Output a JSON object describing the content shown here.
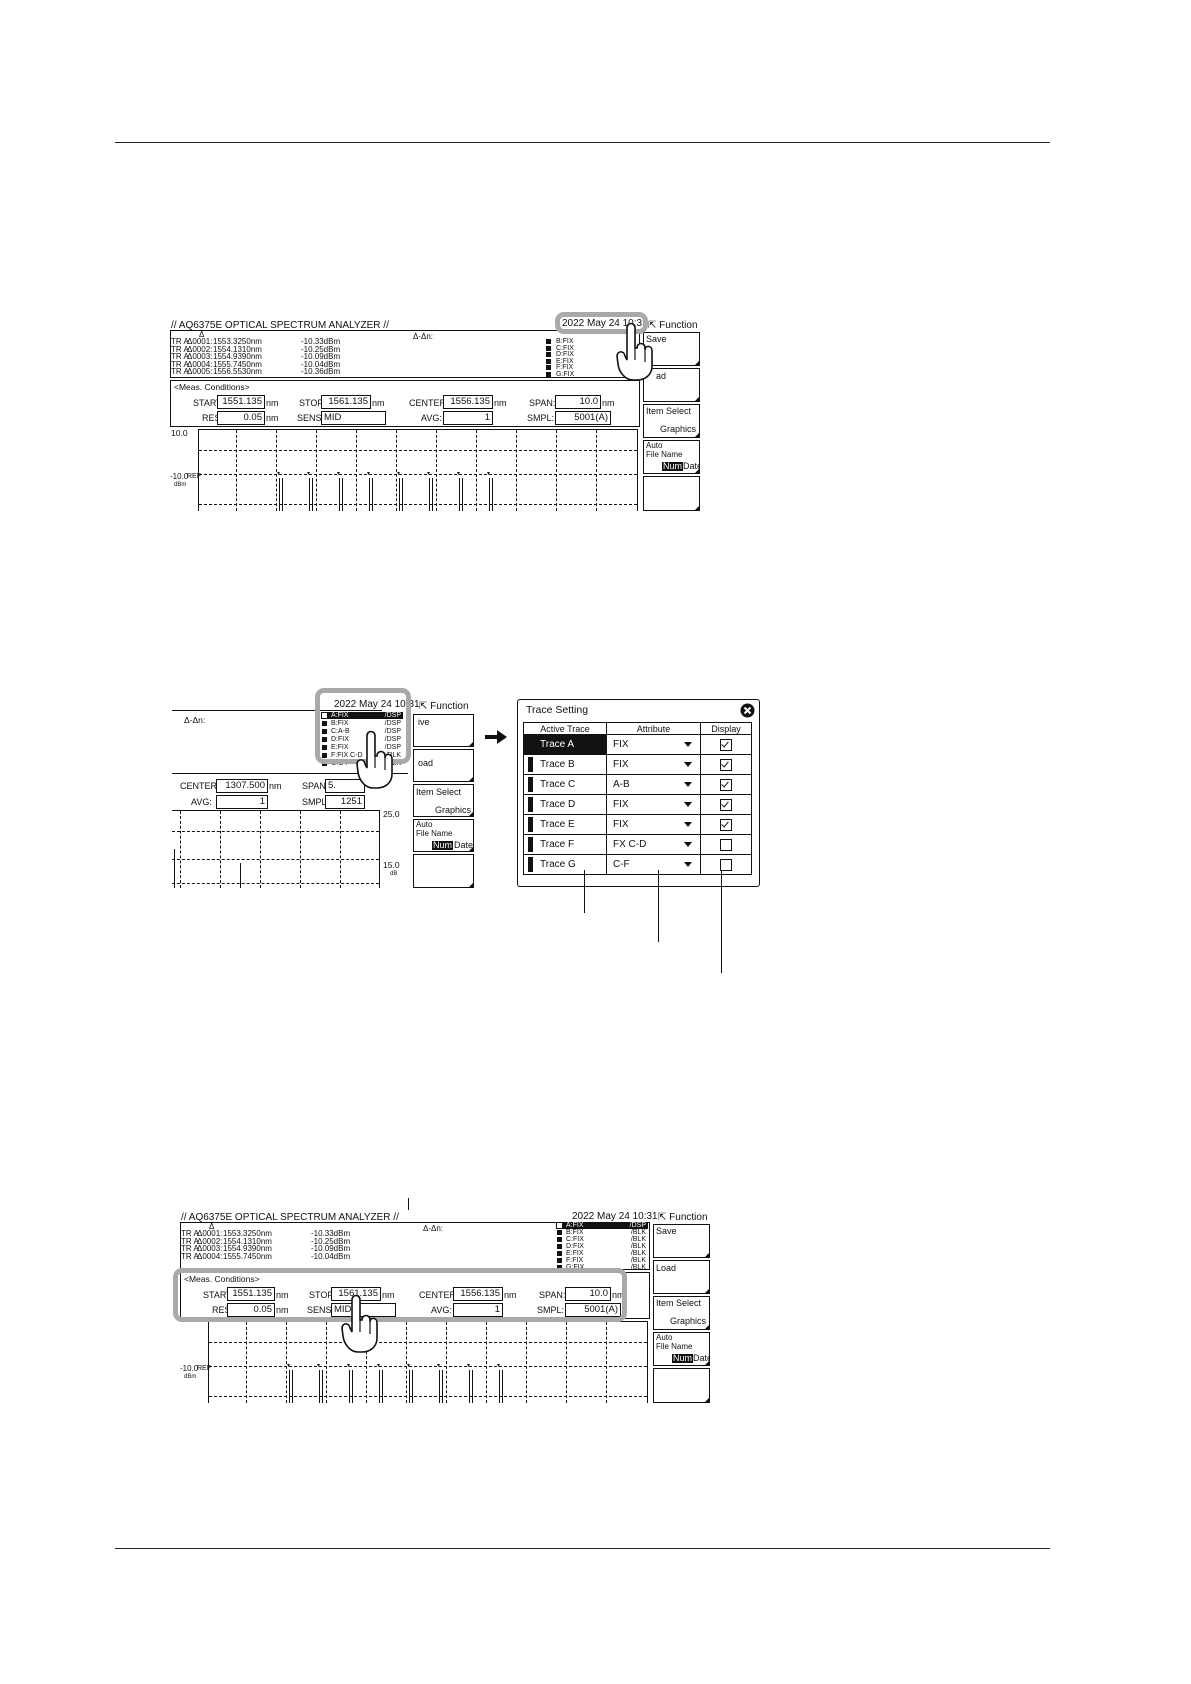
{
  "screen1": {
    "header_title": "// AQ6375E OPTICAL SPECTRUM ANALYZER //",
    "datetime": "2022 May 24 10:31",
    "delta_symbol": "Δ",
    "delta_label": "Δ-Δn:",
    "markers": [
      {
        "tr": "TR A",
        "id": "Δ0001:",
        "wl": "1553.3250nm",
        "lvl": "-10.33dBm"
      },
      {
        "tr": "TR A",
        "id": "Δ0002:",
        "wl": "1554.1310nm",
        "lvl": "-10.25dBm"
      },
      {
        "tr": "TR A",
        "id": "Δ0003:",
        "wl": "1554.9390nm",
        "lvl": "-10.09dBm"
      },
      {
        "tr": "TR A",
        "id": "Δ0004:",
        "wl": "1555.7450nm",
        "lvl": "-10.04dBm"
      },
      {
        "tr": "TR A",
        "id": "Δ0005:",
        "wl": "1556.5530nm",
        "lvl": "-10.36dBm"
      }
    ],
    "trace_list": [
      "B:FIX",
      "C:FIX",
      "D:FIX",
      "E:FIX",
      "F:FIX",
      "G:FIX"
    ],
    "meas_title": "<Meas. Conditions>",
    "start_label": "START:",
    "start_value": "1551.135",
    "start_unit": "nm",
    "stop_label": "STOP:",
    "stop_value": "1561.135",
    "stop_unit": "nm",
    "center_label": "CENTER:",
    "center_value": "1556.135",
    "center_unit": "nm",
    "span_label": "SPAN:",
    "span_value": "10.0",
    "span_unit": "nm",
    "res_label": "RES:",
    "res_value": "0.05",
    "res_unit": "nm",
    "sens_label": "SENS:",
    "sens_value": "MID",
    "avg_label": "AVG:",
    "avg_value": "1",
    "smpl_label": "SMPL:",
    "smpl_value": "5001(A)",
    "y_top": "10.0",
    "y_ref": "-10.0",
    "ref_label": "REF",
    "y_unit": "dBm",
    "function_label": "Function",
    "soft_keys": {
      "save": "Save",
      "load_partial": "ad",
      "item_select": "Item Select",
      "graphics": "Graphics",
      "auto": "Auto",
      "file_name": "File Name",
      "num": "Num",
      "date": "Date"
    }
  },
  "screen2": {
    "datetime": "2022 May 24 10:31",
    "delta_label": "Δ-Δn:",
    "trace_list": [
      {
        "name": "A:FIX",
        "attr": "/DSP"
      },
      {
        "name": "B:FIX",
        "attr": "/DSP"
      },
      {
        "name": "C:A-B",
        "attr": "/DSP"
      },
      {
        "name": "D:FIX",
        "attr": "/DSP"
      },
      {
        "name": "E:FIX",
        "attr": "/DSP"
      },
      {
        "name": "F:FIX C-D",
        "attr": "/BLK"
      },
      {
        "name": "G:C-F",
        "attr": "/BLK"
      }
    ],
    "center_label": "CENTER:",
    "center_value": "1307.500",
    "center_unit": "nm",
    "span_label": "SPAN:",
    "span_value": "5.",
    "avg_label": "AVG:",
    "avg_value": "1",
    "smpl_label": "SMPL:",
    "smpl_value": "1251",
    "y_a": "25.0",
    "y_b": "15.0",
    "y_unit": "dB",
    "function_label": "Function",
    "soft_keys": {
      "save_partial": "ive",
      "load_partial": "oad",
      "item_select": "Item Select",
      "graphics": "Graphics",
      "auto": "Auto",
      "file_name": "File Name",
      "num": "Num",
      "date": "Date"
    }
  },
  "dialog": {
    "title": "Trace Setting",
    "col_active": "Active Trace",
    "col_attr": "Attribute",
    "col_display": "Display",
    "rows": [
      {
        "trace": "Trace A",
        "attr": "FIX",
        "display": true,
        "active": true
      },
      {
        "trace": "Trace B",
        "attr": "FIX",
        "display": true,
        "active": false
      },
      {
        "trace": "Trace C",
        "attr": "A-B",
        "display": true,
        "active": false
      },
      {
        "trace": "Trace D",
        "attr": "FIX",
        "display": true,
        "active": false
      },
      {
        "trace": "Trace E",
        "attr": "FIX",
        "display": true,
        "active": false
      },
      {
        "trace": "Trace F",
        "attr": "FX C-D",
        "display": false,
        "active": false
      },
      {
        "trace": "Trace G",
        "attr": "C-F",
        "display": false,
        "active": false
      }
    ]
  },
  "screen3": {
    "header_title": "// AQ6375E OPTICAL SPECTRUM ANALYZER //",
    "datetime": "2022 May 24 10:31",
    "delta_symbol": "Δ",
    "delta_label": "Δ-Δn:",
    "markers": [
      {
        "tr": "TR A",
        "id": "Δ0001:",
        "wl": "1553.3250nm",
        "lvl": "-10.33dBm"
      },
      {
        "tr": "TR A",
        "id": "Δ0002:",
        "wl": "1554.1310nm",
        "lvl": "-10.25dBm"
      },
      {
        "tr": "TR A",
        "id": "Δ0003:",
        "wl": "1554.9390nm",
        "lvl": "-10.09dBm"
      },
      {
        "tr": "TR A",
        "id": "Δ0004:",
        "wl": "1555.7450nm",
        "lvl": "-10.04dBm"
      }
    ],
    "trace_list": [
      {
        "name": "A:FIX",
        "attr": "/DSP"
      },
      {
        "name": "B:FIX",
        "attr": "/BLK"
      },
      {
        "name": "C:FIX",
        "attr": "/BLK"
      },
      {
        "name": "D:FIX",
        "attr": "/BLK"
      },
      {
        "name": "E:FIX",
        "attr": "/BLK"
      },
      {
        "name": "F:FIX",
        "attr": "/BLK"
      },
      {
        "name": "G:FIX",
        "attr": "/BLK"
      }
    ],
    "meas_title": "<Meas. Conditions>",
    "start_label": "START:",
    "start_value": "1551.135",
    "start_unit": "nm",
    "stop_label": "STOP:",
    "stop_value": "1561.135",
    "stop_unit": "nm",
    "center_label": "CENTER:",
    "center_value": "1556.135",
    "center_unit": "nm",
    "span_label": "SPAN:",
    "span_value": "10.0",
    "span_unit": "nm",
    "res_label": "RES:",
    "res_value": "0.05",
    "res_unit": "nm",
    "sens_label": "SENS:",
    "sens_value": "MID",
    "avg_label": "AVG:",
    "avg_value": "1",
    "smpl_label": "SMPL:",
    "smpl_value": "5001(A)",
    "y_ref": "-10.0",
    "ref_label": "REF",
    "y_unit": "dBm",
    "function_label": "Function",
    "soft_keys": {
      "save": "Save",
      "load": "Load",
      "item_select": "Item Select",
      "graphics": "Graphics",
      "auto": "Auto",
      "file_name": "File Name",
      "num": "Num",
      "date": "Date"
    }
  },
  "colors": {
    "highlight": "#a9a9a9",
    "ink": "#111111"
  }
}
